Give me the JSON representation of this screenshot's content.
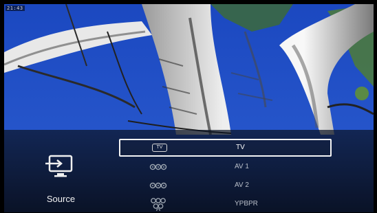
{
  "status": {
    "clock": "21:43"
  },
  "panel": {
    "title": "Source",
    "icon": "source-input-icon"
  },
  "sources": [
    {
      "label": "TV",
      "icon": "tv-badge-icon",
      "badge_text": "TV",
      "selected": true
    },
    {
      "label": "AV 1",
      "icon": "av-ports-icon",
      "selected": false
    },
    {
      "label": "AV 2",
      "icon": "av-ports-icon",
      "selected": false
    },
    {
      "label": "YPBPR",
      "icon": "component-ports-icon",
      "selected": false
    }
  ],
  "colors": {
    "sky": "#1f4fc4",
    "selection_border": "#f4f4f4",
    "label": "#b9bfc9"
  }
}
